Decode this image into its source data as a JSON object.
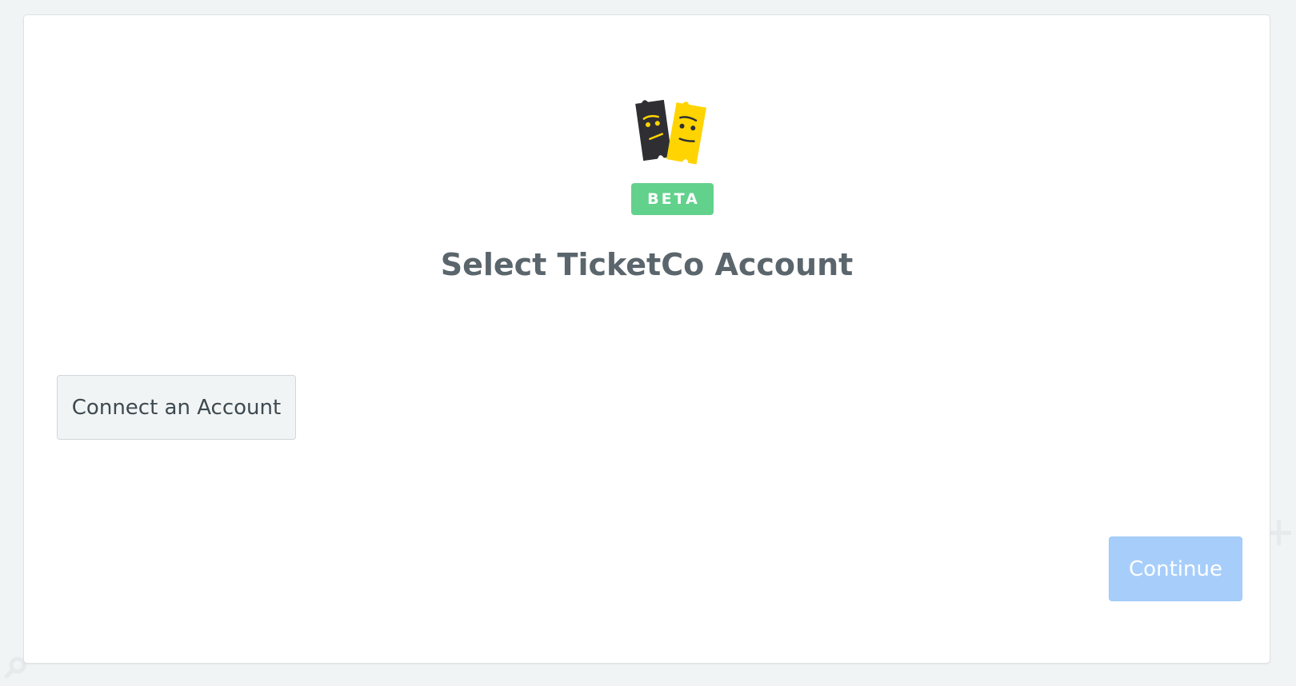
{
  "app": {
    "name": "TicketCo",
    "logo_icon": "ticketco-logo-icon",
    "badge": "BETA",
    "badge_color": "#62d18c"
  },
  "dialog": {
    "title": "Select TicketCo Account",
    "connect_label": "Connect an Account",
    "continue_label": "Continue",
    "continue_enabled": false,
    "accent_color": "#a7cefb"
  },
  "background": {
    "icons": [
      "plus-icon",
      "search-icon"
    ]
  }
}
